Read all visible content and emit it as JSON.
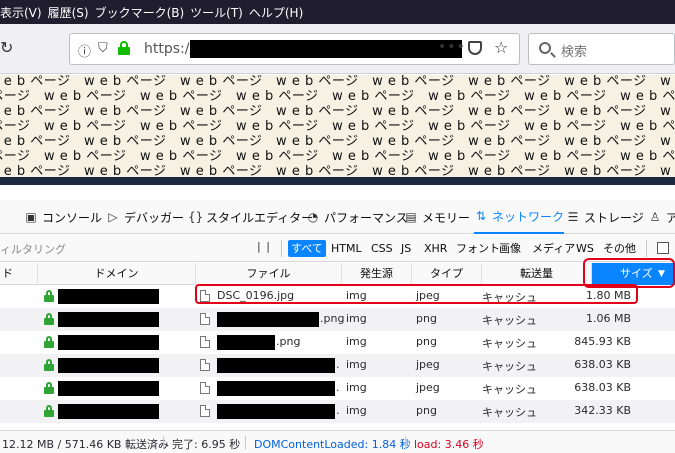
{
  "menu": [
    "表示(V)",
    "履歴(S)",
    "ブックマーク(B)",
    "ツール(T)",
    "ヘルプ(H)"
  ],
  "urlbar": {
    "url": "https://"
  },
  "search": {
    "placeholder": "検索"
  },
  "page_content": {
    "word": "w e b ページ"
  },
  "devtools": {
    "tabs": [
      {
        "label": "コンソール",
        "icon": "console-icon"
      },
      {
        "label": "デバッガー",
        "icon": "debugger-icon"
      },
      {
        "label": "スタイルエディター",
        "icon": "style-editor-icon"
      },
      {
        "label": "パフォーマンス",
        "icon": "performance-icon"
      },
      {
        "label": "メモリー",
        "icon": "memory-icon"
      },
      {
        "label": "ネットワーク",
        "icon": "network-icon"
      },
      {
        "label": "ストレージ",
        "icon": "storage-icon"
      },
      {
        "label": "ア",
        "icon": "accessibility-icon"
      }
    ],
    "active_tab": "ネットワーク",
    "filter_placeholder": "ィルタリング",
    "filters": [
      "すべて",
      "HTML",
      "CSS",
      "JS",
      "XHR",
      "フォント",
      "画像",
      "メディア",
      "WS",
      "その他"
    ],
    "active_filter": "すべて",
    "columns": {
      "status": "ド",
      "domain": "ドメイン",
      "file": "ファイル",
      "cause": "発生源",
      "type": "タイプ",
      "transferred": "転送量",
      "size": "サイズ"
    },
    "rows": [
      {
        "file": "DSC_0196.jpg",
        "cause": "img",
        "type": "jpeg",
        "transferred": "キャッシュ",
        "size": "1.80 MB"
      },
      {
        "file": ".png",
        "cause": "img",
        "type": "png",
        "transferred": "キャッシュ",
        "size": "1.06 MB"
      },
      {
        "file": ".png",
        "cause": "img",
        "type": "png",
        "transferred": "キャッシュ",
        "size": "845.93 KB"
      },
      {
        "file": ".",
        "cause": "img",
        "type": "jpeg",
        "transferred": "キャッシュ",
        "size": "638.03 KB"
      },
      {
        "file": ".",
        "cause": "img",
        "type": "jpeg",
        "transferred": "キャッシュ",
        "size": "638.03 KB"
      },
      {
        "file": ".",
        "cause": "img",
        "type": "png",
        "transferred": "キャッシュ",
        "size": "342.33 KB"
      }
    ],
    "status": {
      "transfer": "12.12 MB / 571.46 KB 転送済み",
      "finish": "完了: 6.95 秒",
      "dcl": "DOMContentLoaded: 1.84 秒",
      "load": "load: 3.46 秒"
    }
  },
  "colors": {
    "accent": "#0a84ff",
    "highlight": "#e0001a",
    "dcl": "#0060df",
    "load": "#d70022",
    "secure": "#12bc00"
  }
}
